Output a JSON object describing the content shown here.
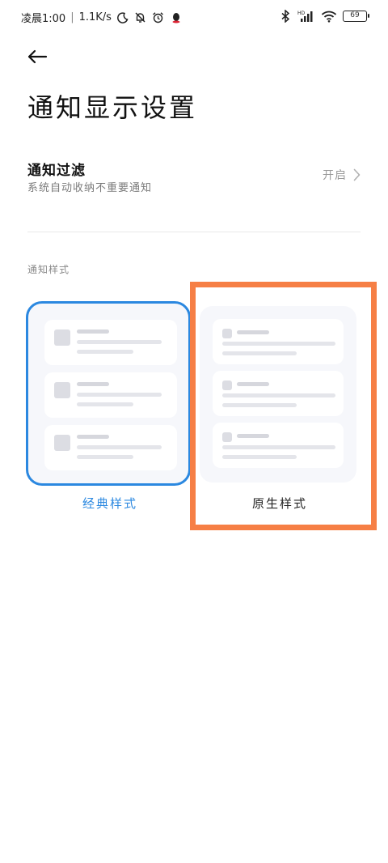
{
  "status_bar": {
    "time": "凌晨1:00",
    "network_speed": "1.1K/s",
    "battery": "69",
    "left_icons": [
      "moon-icon",
      "bell-off-icon",
      "alarm-icon",
      "qq-icon"
    ],
    "right_icons": [
      "bluetooth-icon",
      "signal-hd-icon",
      "wifi-icon",
      "battery-icon"
    ]
  },
  "header": {
    "back_icon": "arrow-left-icon",
    "title": "通知显示设置"
  },
  "filter": {
    "title": "通知过滤",
    "subtitle": "系统自动收纳不重要通知",
    "value": "开启"
  },
  "styles": {
    "section_label": "通知样式",
    "options": [
      {
        "label": "经典样式",
        "selected": true
      },
      {
        "label": "原生样式",
        "selected": false
      }
    ],
    "accent_color": "#2b88e0",
    "highlight_color": "#f67f45"
  }
}
